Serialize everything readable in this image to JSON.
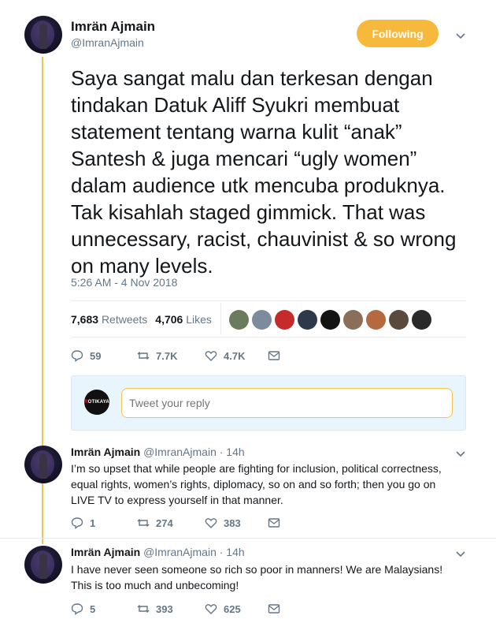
{
  "main_tweet": {
    "author_name": "Imrän Ajmain",
    "author_handle": "@ImranAjmain",
    "follow_label": "Following",
    "text": "Saya sangat malu dan terkesan dengan tindakan Datuk Aliff Syukri membuat statement tentang warna kulit “anak” Santesh & juga mencari “ugly women” dalam audience utk mencuba produknya. Tak kisahlah staged gimmick. That was unnecessary, racist, chauvinist & so wrong on many levels.",
    "timestamp": "5:26 AM - 4 Nov 2018",
    "retweets_count": "7,683",
    "retweets_label": "Retweets",
    "likes_count": "4,706",
    "likes_label": "Likes",
    "actions": {
      "reply": "59",
      "retweet": "7.7K",
      "like": "4.7K"
    }
  },
  "likers": [
    {
      "color": "#6b7b5e"
    },
    {
      "color": "#7d8c9c"
    },
    {
      "color": "#c62a2a"
    },
    {
      "color": "#2e3a4c"
    },
    {
      "color": "#141414"
    },
    {
      "color": "#8a6e58"
    },
    {
      "color": "#b5693f"
    },
    {
      "color": "#5a4a3e"
    },
    {
      "color": "#2a2a2a"
    }
  ],
  "reply_box": {
    "logo_text_r": "R",
    "logo_text_rest": "OTIKAYA",
    "placeholder": "Tweet your reply"
  },
  "replies": [
    {
      "name": "Imrän Ajmain",
      "handle": "@ImranAjmain",
      "time": "· 14h",
      "text": "I’m so upset that while people are fighting for inclusion, political correctness, equal rights, women’s rights, diplomacy, so on and so forth; then you go on LIVE TV to express yourself in that manner.",
      "reply_count": "1",
      "retweet_count": "274",
      "like_count": "383"
    },
    {
      "name": "Imrän Ajmain",
      "handle": "@ImranAjmain",
      "time": "· 14h",
      "text": "I have never seen someone so rich so poor in manners! We are Malaysians! This is too much and unbecoming!",
      "reply_count": "5",
      "retweet_count": "393",
      "like_count": "625"
    }
  ]
}
